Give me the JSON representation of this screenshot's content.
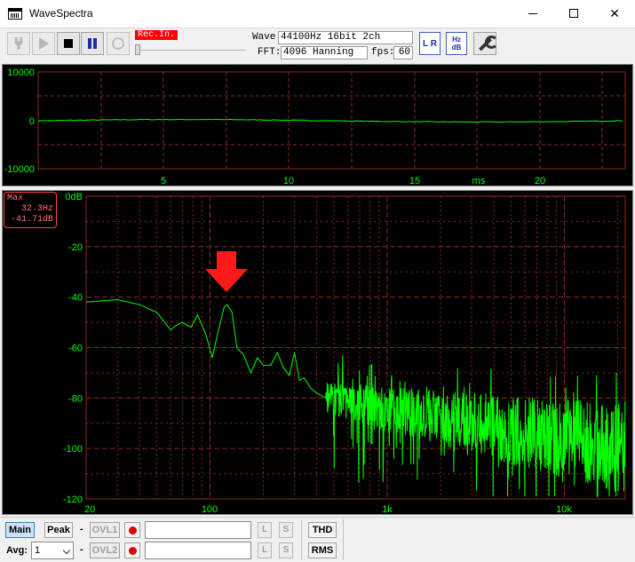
{
  "window": {
    "title": "WaveSpectra"
  },
  "toolbar": {
    "rec_label": "Rec.In.",
    "wave_label": "Wave:",
    "wave_value": "44100Hz 16bit 2ch",
    "fft_label": "FFT:",
    "fft_value": "4096 Hanning",
    "fps_label": "fps:",
    "fps_value": "60",
    "lr_icon": "L R",
    "hz_icon": "Hz dB"
  },
  "waveform": {
    "y_ticks": [
      "10000",
      "0",
      "-10000"
    ],
    "x_ticks": [
      "5",
      "10",
      "15",
      "20"
    ],
    "x_unit": "ms"
  },
  "spectrum": {
    "max_box": {
      "title": "Max",
      "freq": "32.3Hz",
      "level": "-41.71dB"
    },
    "y_ticks": [
      "0dB",
      "-20",
      "-40",
      "-60",
      "-80",
      "-100",
      "-120"
    ],
    "x_ticks": [
      "20",
      "100",
      "1k",
      "10k"
    ]
  },
  "bottom": {
    "main_label": "Main",
    "peak_label": "Peak",
    "ovl1_label": "OVL1",
    "ovl2_label": "OVL2",
    "dash": "-",
    "l_label": "L",
    "s_label": "S",
    "thd_label": "THD",
    "rms_label": "RMS",
    "avg_label": "Avg:",
    "avg_value": "1"
  },
  "colors": {
    "trace": "#00ff00",
    "grid": "#8b2a1a",
    "axis_text": "#00ff00",
    "annotation_arrow": "#ff0000"
  }
}
